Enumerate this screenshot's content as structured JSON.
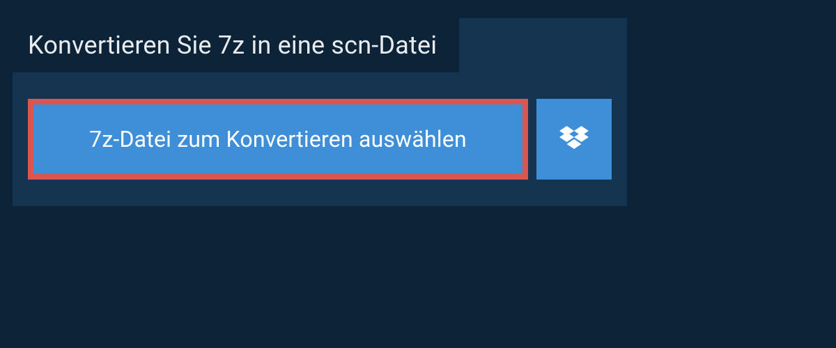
{
  "header": {
    "title": "Konvertieren Sie 7z in eine scn-Datei"
  },
  "actions": {
    "select_file_label": "7z-Datei zum Konvertieren auswählen",
    "dropbox_icon": "dropbox-icon"
  },
  "colors": {
    "background": "#0d2438",
    "panel": "#153450",
    "button": "#3e8fd8",
    "highlight_border": "#d9574f",
    "text_light": "#e8ecef"
  }
}
